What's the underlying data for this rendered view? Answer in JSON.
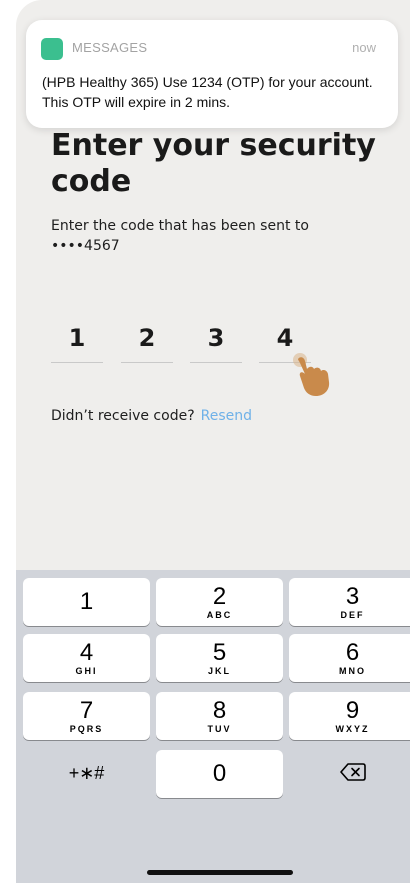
{
  "notification": {
    "app_name": "MESSAGES",
    "time": "now",
    "body": "(HPB Healthy 365) Use 1234 (OTP) for your account.  This OTP will expire in 2 mins.",
    "app_icon_color": "#3bbf8f"
  },
  "screen": {
    "title": "Enter your security code",
    "subtitle": "Enter the code that has been sent to ••••4567",
    "otp_digits": [
      "1",
      "2",
      "3",
      "4"
    ],
    "resend_prompt": "Didn’t receive code?",
    "resend_link": "Resend",
    "link_color": "#6fb1e8"
  },
  "keyboard": {
    "keys": [
      {
        "num": "1",
        "letters": ""
      },
      {
        "num": "2",
        "letters": "ABC"
      },
      {
        "num": "3",
        "letters": "DEF"
      },
      {
        "num": "4",
        "letters": "GHI"
      },
      {
        "num": "5",
        "letters": "JKL"
      },
      {
        "num": "6",
        "letters": "MNO"
      },
      {
        "num": "7",
        "letters": "PQRS"
      },
      {
        "num": "8",
        "letters": "TUV"
      },
      {
        "num": "9",
        "letters": "WXYZ"
      },
      {
        "num": "+∗#",
        "letters": ""
      },
      {
        "num": "0",
        "letters": ""
      },
      {
        "num": "",
        "letters": "",
        "icon": "backspace-icon"
      }
    ]
  }
}
